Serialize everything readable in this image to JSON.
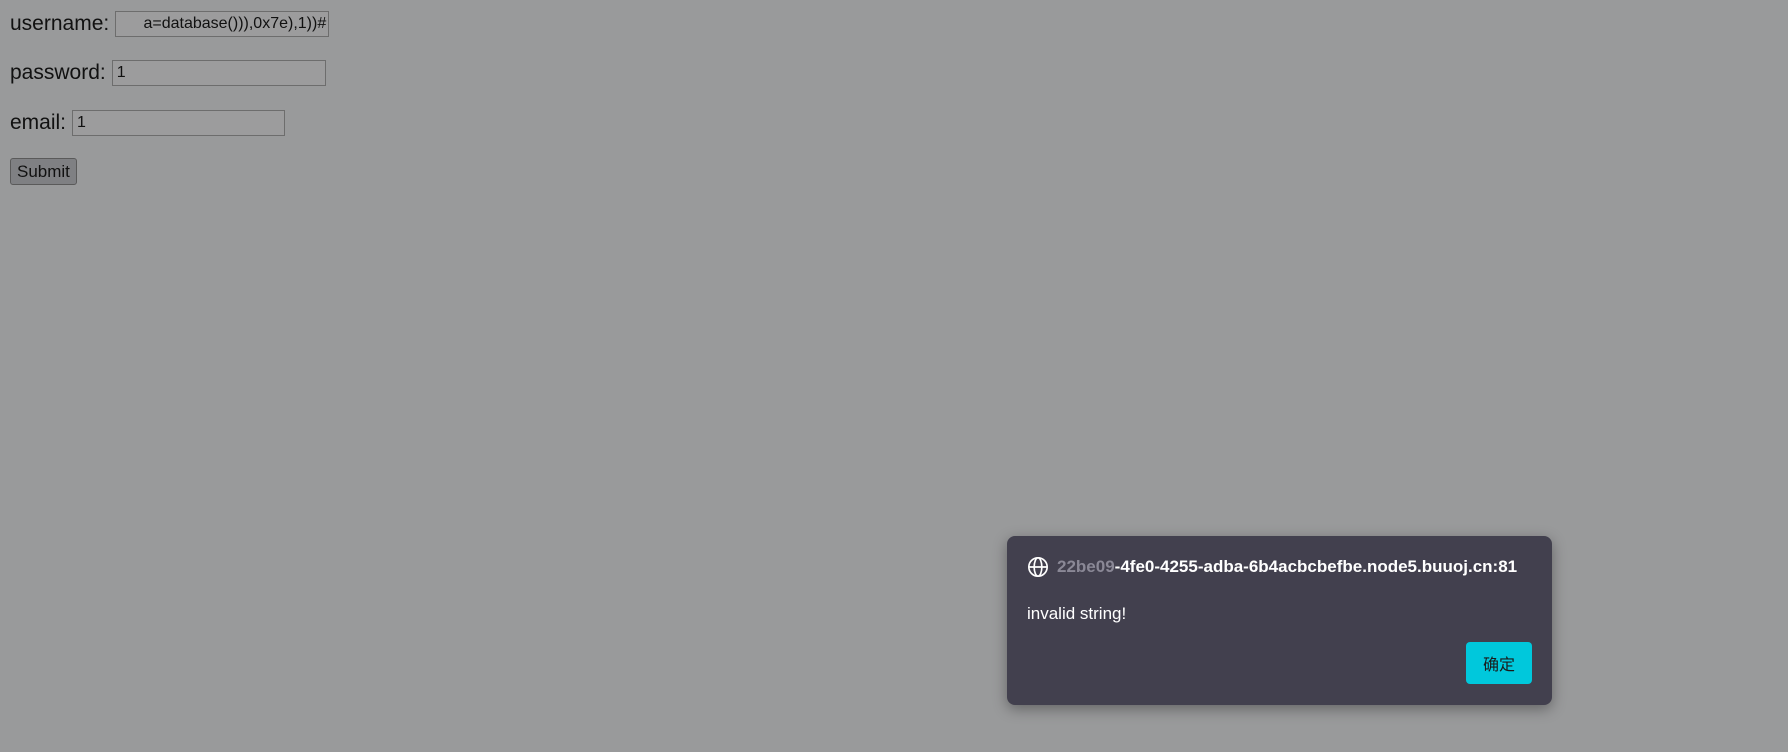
{
  "form": {
    "username_label": "username:",
    "username_value": "a=database())),0x7e),1))#",
    "password_label": "password:",
    "password_value": "1",
    "email_label": "email:",
    "email_value": "1",
    "submit_label": "Submit"
  },
  "dialog": {
    "origin_prefix": "22be09",
    "origin_rest": "-4fe0-4255-adba-6b4acbcbefbe.node5.buuoj.cn:81",
    "message": "invalid string!",
    "ok_label": "确定",
    "icon": "globe-icon"
  },
  "colors": {
    "page_background": "#999a9b",
    "dialog_background": "#42404e",
    "ok_button": "#00c8dc"
  }
}
